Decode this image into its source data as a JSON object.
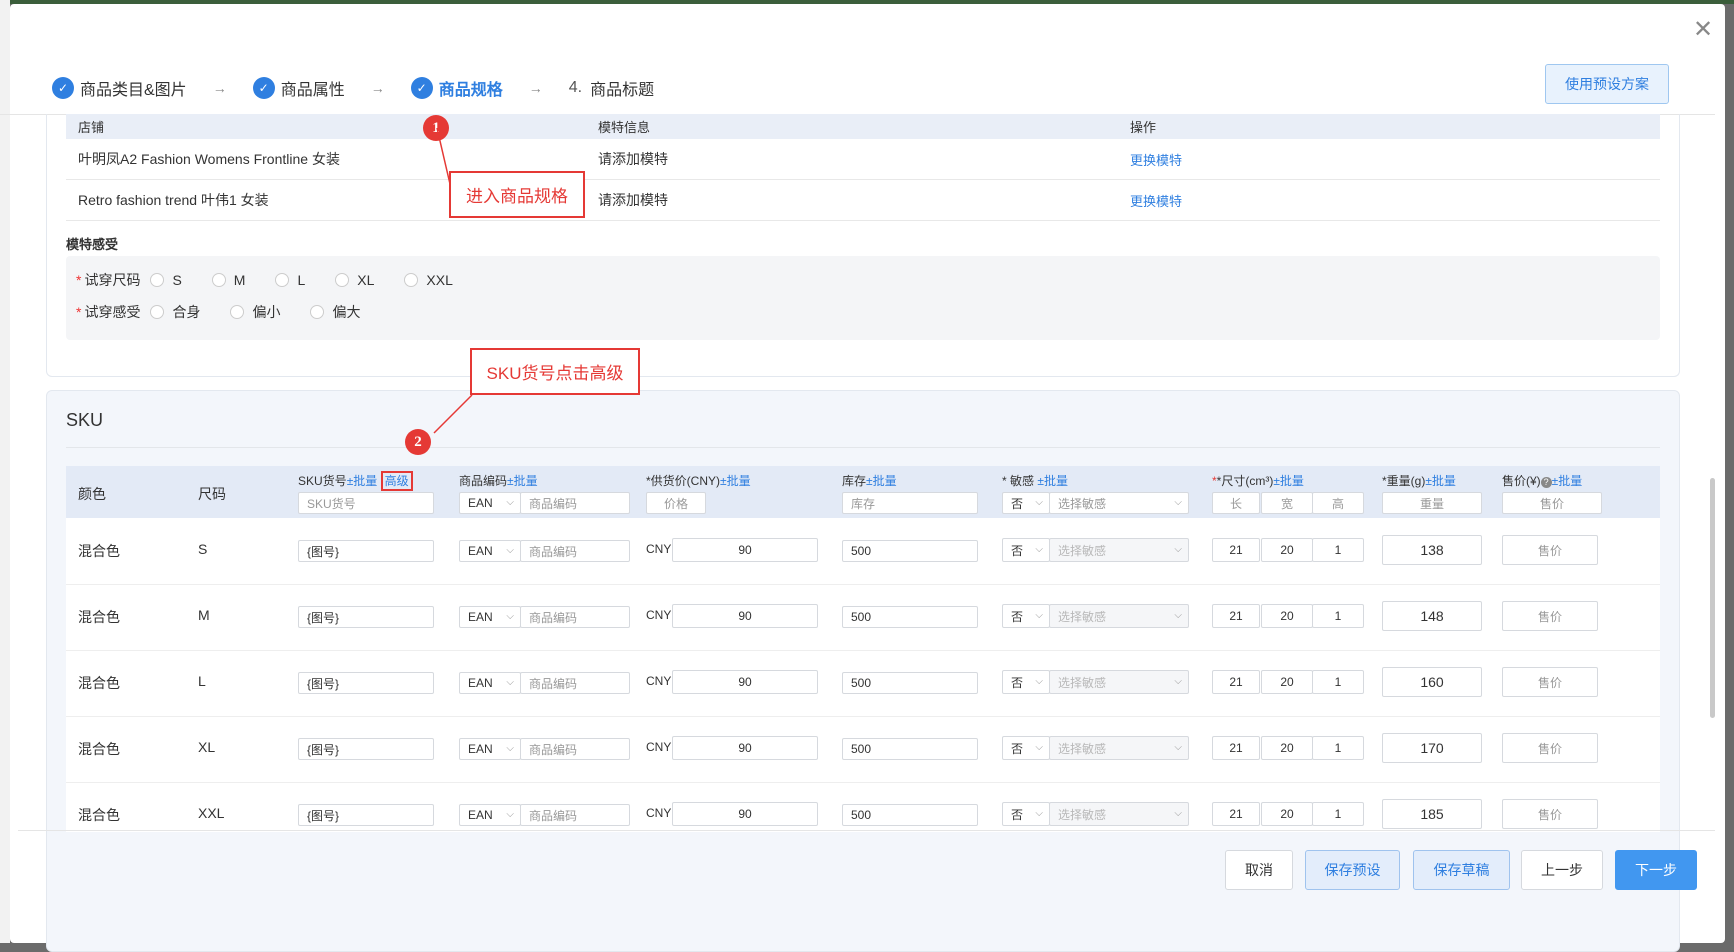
{
  "window": {
    "close_glyph": "✕"
  },
  "steps": [
    {
      "label": "商品类目&图片"
    },
    {
      "label": "商品属性"
    },
    {
      "label": "商品规格"
    },
    {
      "number": "4.",
      "label": "商品标题"
    }
  ],
  "step_arrow": "→",
  "step_check_glyph": "✓",
  "preset_button": "使用预设方案",
  "model_table": {
    "headers": [
      "店铺",
      "模特信息",
      "操作"
    ],
    "rows": [
      {
        "store": "叶明凤A2 Fashion Womens Frontline 女装",
        "model": "请添加模特",
        "action": "更换模特"
      },
      {
        "store": "Retro fashion trend 叶伟1 女装",
        "model": "请添加模特",
        "action": "更换模特"
      }
    ]
  },
  "model_feel": {
    "title": "模特感受",
    "required_mark": "*",
    "size_label": "试穿尺码",
    "sizes": [
      "S",
      "M",
      "L",
      "XL",
      "XXL"
    ],
    "feel_label": "试穿感受",
    "feels": [
      "合身",
      "偏小",
      "偏大"
    ]
  },
  "sku": {
    "title": "SKU",
    "headers": {
      "color": "颜色",
      "size": "尺码",
      "sku_no": "SKU货号",
      "batch": "±批量",
      "advanced": "高级",
      "product_code": "商品编码",
      "supply_price": "*供货价(CNY)",
      "stock": "库存",
      "sensitive": "* 敏感",
      "dimensions": "*尺寸(cm³)",
      "weight": "*重量(g)",
      "sale_price": "售价(¥)"
    },
    "help_glyph": "?",
    "header_placeholders": {
      "sku_no": "SKU货号",
      "code_type": "EAN",
      "code": "商品编码",
      "price": "价格",
      "stock": "库存",
      "sensitive_flag": "否",
      "sensitive": "选择敏感",
      "length": "长",
      "width": "宽",
      "height": "高",
      "weight": "重量",
      "sale_price": "售价"
    },
    "currency": "CNY",
    "dropdown_glyph": "⌵",
    "rows": [
      {
        "color": "混合色",
        "size": "S",
        "sku_no": "{图号}",
        "code_type": "EAN",
        "code_placeholder": "商品编码",
        "price": "90",
        "stock": "500",
        "sensitive_flag": "否",
        "sensitive_placeholder": "选择敏感",
        "length": "21",
        "width": "20",
        "height": "1",
        "weight": "138",
        "sale_placeholder": "售价"
      },
      {
        "color": "混合色",
        "size": "M",
        "sku_no": "{图号}",
        "code_type": "EAN",
        "code_placeholder": "商品编码",
        "price": "90",
        "stock": "500",
        "sensitive_flag": "否",
        "sensitive_placeholder": "选择敏感",
        "length": "21",
        "width": "20",
        "height": "1",
        "weight": "148",
        "sale_placeholder": "售价"
      },
      {
        "color": "混合色",
        "size": "L",
        "sku_no": "{图号}",
        "code_type": "EAN",
        "code_placeholder": "商品编码",
        "price": "90",
        "stock": "500",
        "sensitive_flag": "否",
        "sensitive_placeholder": "选择敏感",
        "length": "21",
        "width": "20",
        "height": "1",
        "weight": "160",
        "sale_placeholder": "售价"
      },
      {
        "color": "混合色",
        "size": "XL",
        "sku_no": "{图号}",
        "code_type": "EAN",
        "code_placeholder": "商品编码",
        "price": "90",
        "stock": "500",
        "sensitive_flag": "否",
        "sensitive_placeholder": "选择敏感",
        "length": "21",
        "width": "20",
        "height": "1",
        "weight": "170",
        "sale_placeholder": "售价"
      },
      {
        "color": "混合色",
        "size": "XXL",
        "sku_no": "{图号}",
        "code_type": "EAN",
        "code_placeholder": "商品编码",
        "price": "90",
        "stock": "500",
        "sensitive_flag": "否",
        "sensitive_placeholder": "选择敏感",
        "length": "21",
        "width": "20",
        "height": "1",
        "weight": "185",
        "sale_placeholder": "售价"
      }
    ]
  },
  "annotations": [
    {
      "number": "1",
      "text": "进入商品规格"
    },
    {
      "number": "2",
      "text": "SKU货号点击高级"
    }
  ],
  "footer": {
    "cancel": "取消",
    "save_preset": "保存预设",
    "save_draft": "保存草稿",
    "prev": "上一步",
    "next": "下一步"
  },
  "colors": {
    "primary": "#2f7fe0",
    "annotation": "#e53935"
  }
}
